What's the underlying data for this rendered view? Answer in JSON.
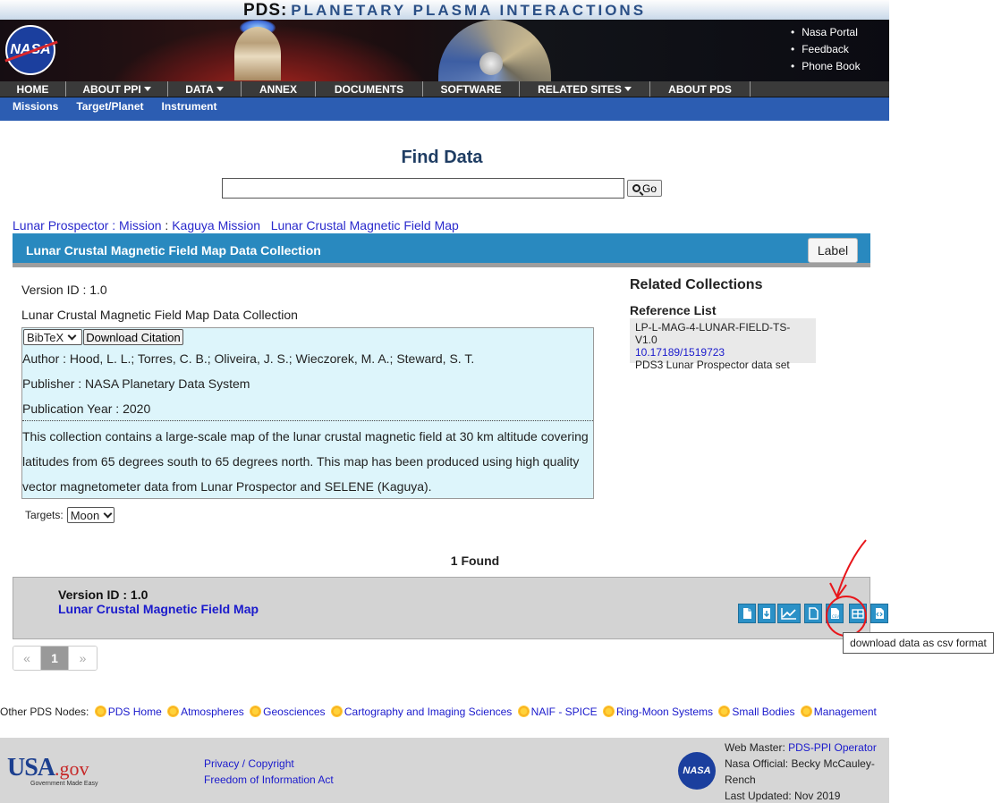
{
  "banner": {
    "title_pds": "PDS:",
    "title_rest": "PLANETARY PLASMA INTERACTIONS",
    "logo_text": "NASA",
    "top_links": [
      "Nasa Portal",
      "Feedback",
      "Phone Book"
    ]
  },
  "nav": {
    "items": [
      {
        "label": "HOME",
        "dropdown": false
      },
      {
        "label": "ABOUT PPI",
        "dropdown": true
      },
      {
        "label": "DATA",
        "dropdown": true
      },
      {
        "label": "ANNEX",
        "dropdown": false
      },
      {
        "label": "DOCUMENTS",
        "dropdown": false
      },
      {
        "label": "SOFTWARE",
        "dropdown": false
      },
      {
        "label": "RELATED SITES",
        "dropdown": true
      },
      {
        "label": "ABOUT PDS",
        "dropdown": false
      }
    ],
    "sub_items": [
      "Missions",
      "Target/Planet",
      "Instrument"
    ]
  },
  "find": {
    "title": "Find Data",
    "search_value": "",
    "go_label": "Go"
  },
  "breadcrumb": {
    "link1": "Lunar Prospector : Mission",
    "sep": " : ",
    "link2": "Kaguya Mission",
    "link3": "Lunar Crustal Magnetic Field Map"
  },
  "collection": {
    "title": "Lunar Crustal Magnetic Field Map Data Collection",
    "label_button": "Label",
    "version_id": "Version ID : 1.0",
    "name": "Lunar Crustal Magnetic Field Map Data Collection",
    "citation_format": "BibTeX",
    "download_citation": "Download Citation",
    "author": "Author : Hood, L. L.; Torres, C. B.; Oliveira, J. S.; Wieczorek, M. A.; Steward, S. T.",
    "publisher": "Publisher : NASA Planetary Data System",
    "year": "Publication Year : 2020",
    "description": "This collection contains a large-scale map of the lunar crustal magnetic field at 30 km altitude covering latitudes from 65 degrees south to 65 degrees north. This map has been produced using high quality vector magnetometer data from Lunar Prospector and SELENE (Kaguya).",
    "targets_label": "Targets:",
    "target_value": "Moon"
  },
  "related": {
    "title": "Related Collections",
    "ref_title": "Reference List",
    "ref_id": "LP-L-MAG-4-LUNAR-FIELD-TS-V1.0",
    "ref_doi": "10.17189/1519723",
    "ref_desc": "PDS3 Lunar Prospector data set"
  },
  "results": {
    "found": "1 Found",
    "version_id": "Version ID : 1.0",
    "link": "Lunar Crustal Magnetic Field Map",
    "icons": [
      "file-icon",
      "download-icon",
      "chart-icon",
      "document-icon",
      "csv-icon",
      "table-icon",
      "code-icon"
    ],
    "tooltip": "download data as csv format"
  },
  "pager": {
    "prev": "«",
    "current": "1",
    "next": "»"
  },
  "nodes": {
    "label": "Other PDS Nodes:",
    "items": [
      "PDS Home",
      "Atmospheres",
      "Geosciences",
      "Cartography and Imaging Sciences",
      "NAIF - SPICE",
      "Ring-Moon Systems",
      "Small Bodies",
      "Management"
    ]
  },
  "footer": {
    "usa_text": "USA",
    "gov_text": ".gov",
    "usa_tagline": "Government Made Easy",
    "privacy": "Privacy / Copyright",
    "foia": "Freedom of Information Act",
    "nasa_logo": "NASA",
    "webmaster_label": "Web Master: ",
    "webmaster_link": "PDS-PPI Operator",
    "official": "Nasa Official: Becky McCauley-Rench",
    "updated": "Last Updated: Nov 2019"
  },
  "colors": {
    "nav_bg": "#3a3a3a",
    "subnav_bg": "#2c5db2",
    "collection_bar": "#2989bf",
    "citation_bg": "#ddf5fb",
    "icon_blue": "#2b91c7",
    "annotation_red": "#e8161b"
  }
}
